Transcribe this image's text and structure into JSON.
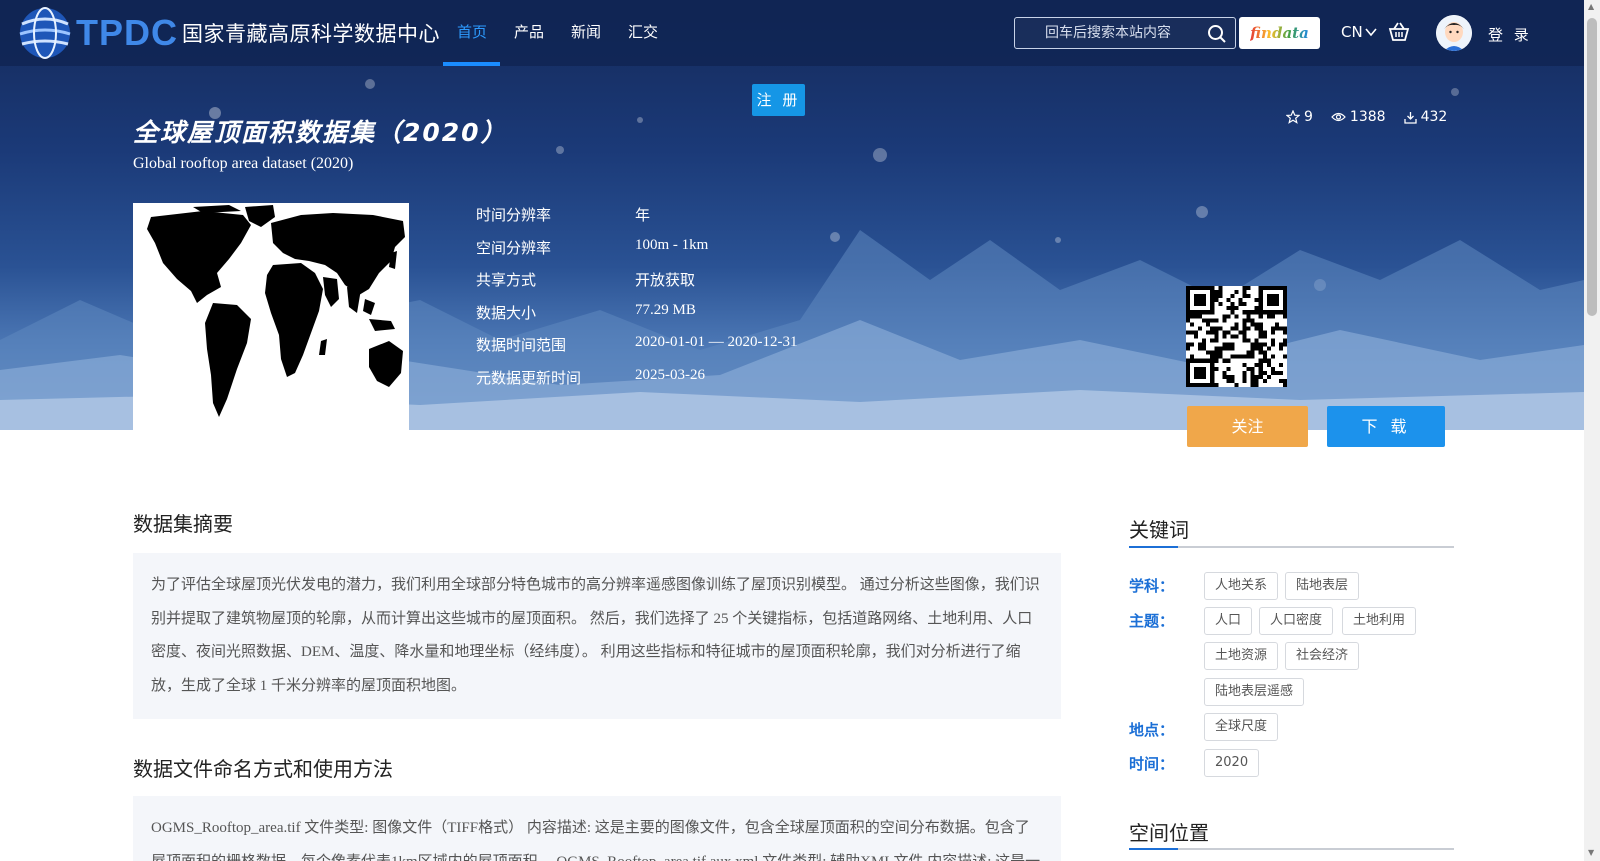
{
  "nav": {
    "logo_abbr": "TPDC",
    "logo_name": "国家青藏高原科学数据中心",
    "items": [
      {
        "label": "首页",
        "active": true
      },
      {
        "label": "产品",
        "active": false
      },
      {
        "label": "新闻",
        "active": false
      },
      {
        "label": "汇交",
        "active": false
      }
    ],
    "search_placeholder": "回车后搜索本站内容",
    "findata_label": "findata",
    "lang_label": "CN",
    "login_label": "登 录"
  },
  "register_label": "注 册",
  "dataset": {
    "title_cn": "全球屋顶面积数据集（2020）",
    "title_en": "Global rooftop area dataset (2020)",
    "stats": {
      "stars": "9",
      "views": "1388",
      "downloads": "432"
    },
    "meta": [
      {
        "key": "时间分辨率",
        "value": "年"
      },
      {
        "key": "空间分辨率",
        "value": "100m - 1km"
      },
      {
        "key": "共享方式",
        "value": "开放获取"
      },
      {
        "key": "数据大小",
        "value": "77.29 MB"
      },
      {
        "key": "数据时间范围",
        "value": "2020-01-01 — 2020-12-31"
      },
      {
        "key": "元数据更新时间",
        "value": "2025-03-26"
      }
    ],
    "follow_label": "关注",
    "download_label": "下 载"
  },
  "sections": {
    "abstract_title": "数据集摘要",
    "abstract_text": "为了评估全球屋顶光伏发电的潜力，我们利用全球部分特色城市的高分辨率遥感图像训练了屋顶识别模型。 通过分析这些图像，我们识别并提取了建筑物屋顶的轮廓，从而计算出这些城市的屋顶面积。 然后，我们选择了 25 个关键指标，包括道路网络、土地利用、人口密度、夜间光照数据、DEM、温度、降水量和地理坐标（经纬度）。 利用这些指标和特征城市的屋顶面积轮廓，我们对分析进行了缩放，生成了全球 1 千米分辨率的屋顶面积地图。",
    "files_title": "数据文件命名方式和使用方法",
    "files_text": "OGMS_Rooftop_area.tif 文件类型: 图像文件（TIFF格式） 内容描述: 这是主要的图像文件，包含全球屋顶面积的空间分布数据。包含了屋顶面积的栅格数据，每个像素代表1km区域内的屋顶面积。 OGMS_Rooftop_area.tif.aux.xml 文件类型: 辅助XML文件 内容描述: 这是一"
  },
  "sidebar": {
    "keywords_title": "关键词",
    "groups": [
      {
        "label": "学科：",
        "tags": [
          "人地关系",
          "陆地表层"
        ]
      },
      {
        "label": "主题：",
        "tags": [
          "人口",
          "人口密度",
          "土地利用",
          "土地资源",
          "社会经济",
          "陆地表层遥感"
        ]
      },
      {
        "label": "地点：",
        "tags": [
          "全球尺度"
        ]
      },
      {
        "label": "时间：",
        "tags": [
          "2020"
        ]
      }
    ],
    "location_title": "空间位置"
  },
  "icons": {
    "search": "search-icon",
    "cart": "basket-icon",
    "star": "star-icon",
    "eye": "eye-icon",
    "download": "download-icon",
    "chevron": "chevron-down-icon"
  }
}
